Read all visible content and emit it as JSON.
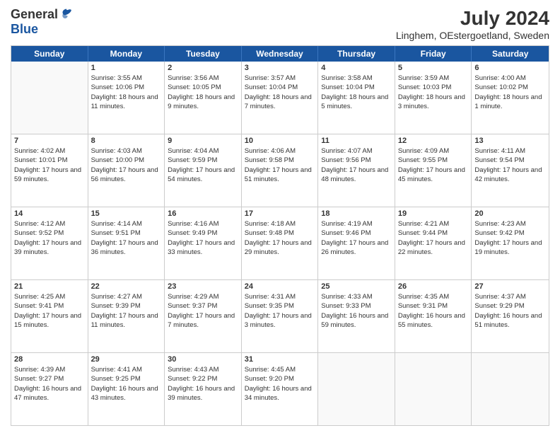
{
  "header": {
    "logo_general": "General",
    "logo_blue": "Blue",
    "month_year": "July 2024",
    "location": "Linghem, OEstergoetland, Sweden"
  },
  "weekdays": [
    "Sunday",
    "Monday",
    "Tuesday",
    "Wednesday",
    "Thursday",
    "Friday",
    "Saturday"
  ],
  "weeks": [
    [
      {
        "day": "",
        "empty": true
      },
      {
        "day": "1",
        "sunrise": "3:55 AM",
        "sunset": "10:06 PM",
        "daylight": "18 hours and 11 minutes."
      },
      {
        "day": "2",
        "sunrise": "3:56 AM",
        "sunset": "10:05 PM",
        "daylight": "18 hours and 9 minutes."
      },
      {
        "day": "3",
        "sunrise": "3:57 AM",
        "sunset": "10:04 PM",
        "daylight": "18 hours and 7 minutes."
      },
      {
        "day": "4",
        "sunrise": "3:58 AM",
        "sunset": "10:04 PM",
        "daylight": "18 hours and 5 minutes."
      },
      {
        "day": "5",
        "sunrise": "3:59 AM",
        "sunset": "10:03 PM",
        "daylight": "18 hours and 3 minutes."
      },
      {
        "day": "6",
        "sunrise": "4:00 AM",
        "sunset": "10:02 PM",
        "daylight": "18 hours and 1 minute."
      }
    ],
    [
      {
        "day": "7",
        "sunrise": "4:02 AM",
        "sunset": "10:01 PM",
        "daylight": "17 hours and 59 minutes."
      },
      {
        "day": "8",
        "sunrise": "4:03 AM",
        "sunset": "10:00 PM",
        "daylight": "17 hours and 56 minutes."
      },
      {
        "day": "9",
        "sunrise": "4:04 AM",
        "sunset": "9:59 PM",
        "daylight": "17 hours and 54 minutes."
      },
      {
        "day": "10",
        "sunrise": "4:06 AM",
        "sunset": "9:58 PM",
        "daylight": "17 hours and 51 minutes."
      },
      {
        "day": "11",
        "sunrise": "4:07 AM",
        "sunset": "9:56 PM",
        "daylight": "17 hours and 48 minutes."
      },
      {
        "day": "12",
        "sunrise": "4:09 AM",
        "sunset": "9:55 PM",
        "daylight": "17 hours and 45 minutes."
      },
      {
        "day": "13",
        "sunrise": "4:11 AM",
        "sunset": "9:54 PM",
        "daylight": "17 hours and 42 minutes."
      }
    ],
    [
      {
        "day": "14",
        "sunrise": "4:12 AM",
        "sunset": "9:52 PM",
        "daylight": "17 hours and 39 minutes."
      },
      {
        "day": "15",
        "sunrise": "4:14 AM",
        "sunset": "9:51 PM",
        "daylight": "17 hours and 36 minutes."
      },
      {
        "day": "16",
        "sunrise": "4:16 AM",
        "sunset": "9:49 PM",
        "daylight": "17 hours and 33 minutes."
      },
      {
        "day": "17",
        "sunrise": "4:18 AM",
        "sunset": "9:48 PM",
        "daylight": "17 hours and 29 minutes."
      },
      {
        "day": "18",
        "sunrise": "4:19 AM",
        "sunset": "9:46 PM",
        "daylight": "17 hours and 26 minutes."
      },
      {
        "day": "19",
        "sunrise": "4:21 AM",
        "sunset": "9:44 PM",
        "daylight": "17 hours and 22 minutes."
      },
      {
        "day": "20",
        "sunrise": "4:23 AM",
        "sunset": "9:42 PM",
        "daylight": "17 hours and 19 minutes."
      }
    ],
    [
      {
        "day": "21",
        "sunrise": "4:25 AM",
        "sunset": "9:41 PM",
        "daylight": "17 hours and 15 minutes."
      },
      {
        "day": "22",
        "sunrise": "4:27 AM",
        "sunset": "9:39 PM",
        "daylight": "17 hours and 11 minutes."
      },
      {
        "day": "23",
        "sunrise": "4:29 AM",
        "sunset": "9:37 PM",
        "daylight": "17 hours and 7 minutes."
      },
      {
        "day": "24",
        "sunrise": "4:31 AM",
        "sunset": "9:35 PM",
        "daylight": "17 hours and 3 minutes."
      },
      {
        "day": "25",
        "sunrise": "4:33 AM",
        "sunset": "9:33 PM",
        "daylight": "16 hours and 59 minutes."
      },
      {
        "day": "26",
        "sunrise": "4:35 AM",
        "sunset": "9:31 PM",
        "daylight": "16 hours and 55 minutes."
      },
      {
        "day": "27",
        "sunrise": "4:37 AM",
        "sunset": "9:29 PM",
        "daylight": "16 hours and 51 minutes."
      }
    ],
    [
      {
        "day": "28",
        "sunrise": "4:39 AM",
        "sunset": "9:27 PM",
        "daylight": "16 hours and 47 minutes."
      },
      {
        "day": "29",
        "sunrise": "4:41 AM",
        "sunset": "9:25 PM",
        "daylight": "16 hours and 43 minutes."
      },
      {
        "day": "30",
        "sunrise": "4:43 AM",
        "sunset": "9:22 PM",
        "daylight": "16 hours and 39 minutes."
      },
      {
        "day": "31",
        "sunrise": "4:45 AM",
        "sunset": "9:20 PM",
        "daylight": "16 hours and 34 minutes."
      },
      {
        "day": "",
        "empty": true
      },
      {
        "day": "",
        "empty": true
      },
      {
        "day": "",
        "empty": true
      }
    ]
  ]
}
